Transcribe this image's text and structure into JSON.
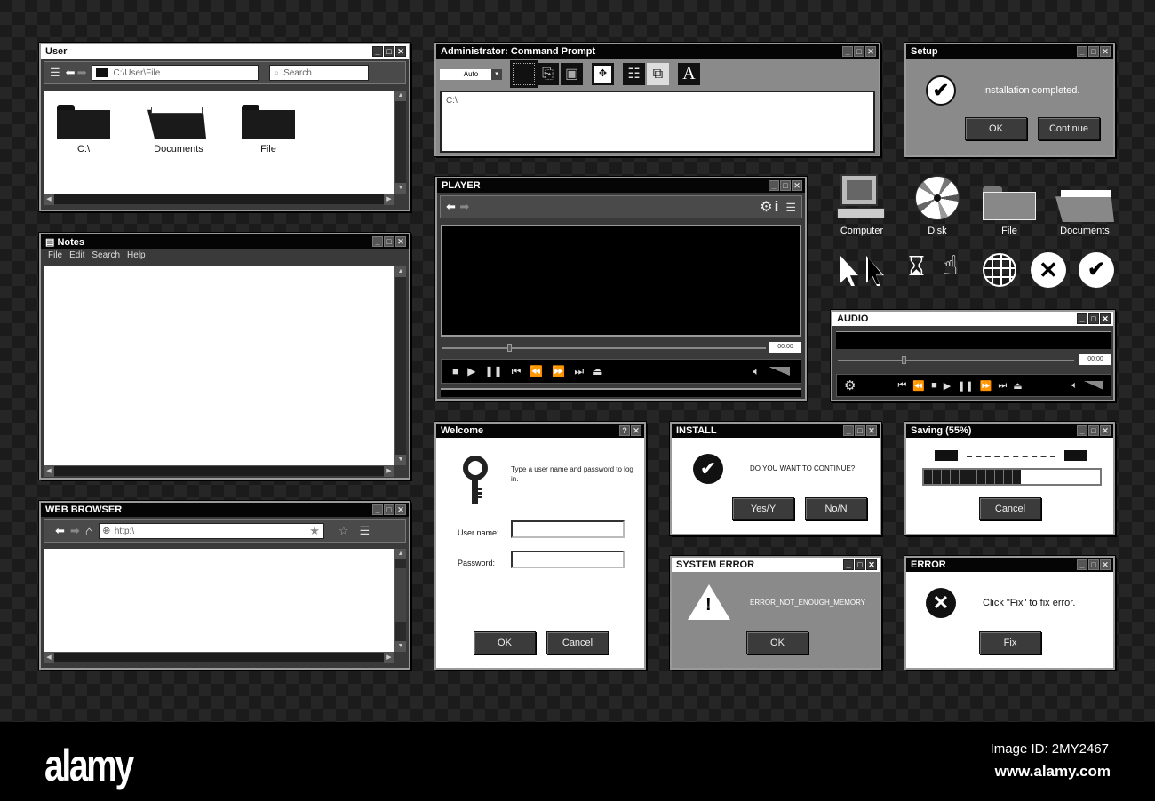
{
  "explorer": {
    "title": "User",
    "path": "C:\\User\\File",
    "search_placeholder": "Search",
    "items": [
      {
        "label": "C:\\",
        "icon": "folder-icon"
      },
      {
        "label": "Documents",
        "icon": "folder-open-icon"
      },
      {
        "label": "File",
        "icon": "folder-icon"
      }
    ]
  },
  "notes": {
    "title": "Notes",
    "menu": [
      "File",
      "Edit",
      "Search",
      "Help"
    ]
  },
  "browser": {
    "title": "WEB BROWSER",
    "url": "http:\\"
  },
  "cmd": {
    "title": "Administrator: Command Prompt",
    "dropdown": "Auto",
    "content": "C:\\",
    "tools": [
      "select-icon",
      "copy-icon",
      "paste-icon",
      "move-icon",
      "properties-icon",
      "windows-icon",
      "font-icon"
    ]
  },
  "player": {
    "title": "PLAYER",
    "time": "00:00",
    "progress": 0.2
  },
  "setup": {
    "title": "Setup",
    "message": "Installation completed.",
    "ok": "OK",
    "continue": "Continue"
  },
  "desktop_icons": [
    {
      "label": "Computer"
    },
    {
      "label": "Disk"
    },
    {
      "label": "File"
    },
    {
      "label": "Documents"
    }
  ],
  "cursors": [
    "arrow-cursor-white-icon",
    "arrow-cursor-black-icon",
    "hourglass-icon",
    "hand-pointer-icon",
    "globe-icon",
    "error-circle-icon",
    "check-circle-icon"
  ],
  "audio": {
    "title": "AUDIO",
    "time": "00:00",
    "progress": 0.27
  },
  "welcome": {
    "title": "Welcome",
    "help": "?",
    "message": "Type a user name and password to log in.",
    "username_label": "User name:",
    "password_label": "Password:",
    "username": "",
    "password": "",
    "ok": "OK",
    "cancel": "Cancel"
  },
  "install": {
    "title": "INSTALL",
    "message": "DO YOU WANT TO CONTINUE?",
    "yes": "Yes/Y",
    "no": "No/N"
  },
  "saving": {
    "title": "Saving (55%)",
    "progress": 0.55,
    "cancel": "Cancel"
  },
  "system_error": {
    "title": "SYSTEM ERROR",
    "message": "ERROR_NOT_ENOUGH_MEMORY",
    "ok": "OK"
  },
  "error": {
    "title": "ERROR",
    "message": "Click \"Fix\" to fix error.",
    "fix": "Fix"
  },
  "watermark": {
    "logo": "alamy",
    "image_id": "Image ID: 2MY2467",
    "url": "www.alamy.com"
  }
}
